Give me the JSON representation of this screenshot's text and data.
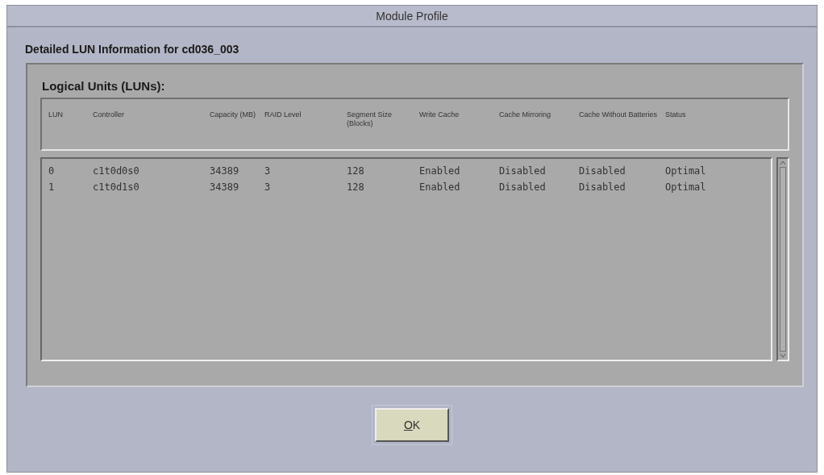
{
  "window": {
    "title": "Module Profile"
  },
  "heading": "Detailed LUN Information for cd036_003",
  "group": {
    "title": "Logical Units (LUNs):"
  },
  "table": {
    "columns": [
      "LUN",
      "Controller",
      "Capacity (MB)",
      "RAID Level",
      "Segment Size (Blocks)",
      "Write Cache",
      "Cache Mirroring",
      "Cache Without Batteries",
      "Status"
    ],
    "rows": [
      {
        "cells": [
          "0",
          "c1t0d0s0",
          "34389",
          "3",
          "128",
          "Enabled",
          "Disabled",
          "Disabled",
          "Optimal"
        ],
        "selected": false
      },
      {
        "cells": [
          "1",
          "c1t0d1s0",
          "34389",
          "3",
          "128",
          "Enabled",
          "Disabled",
          "Disabled",
          "Optimal"
        ],
        "selected": false
      }
    ]
  },
  "buttons": [
    {
      "label": "OK",
      "underline_first": true
    }
  ]
}
